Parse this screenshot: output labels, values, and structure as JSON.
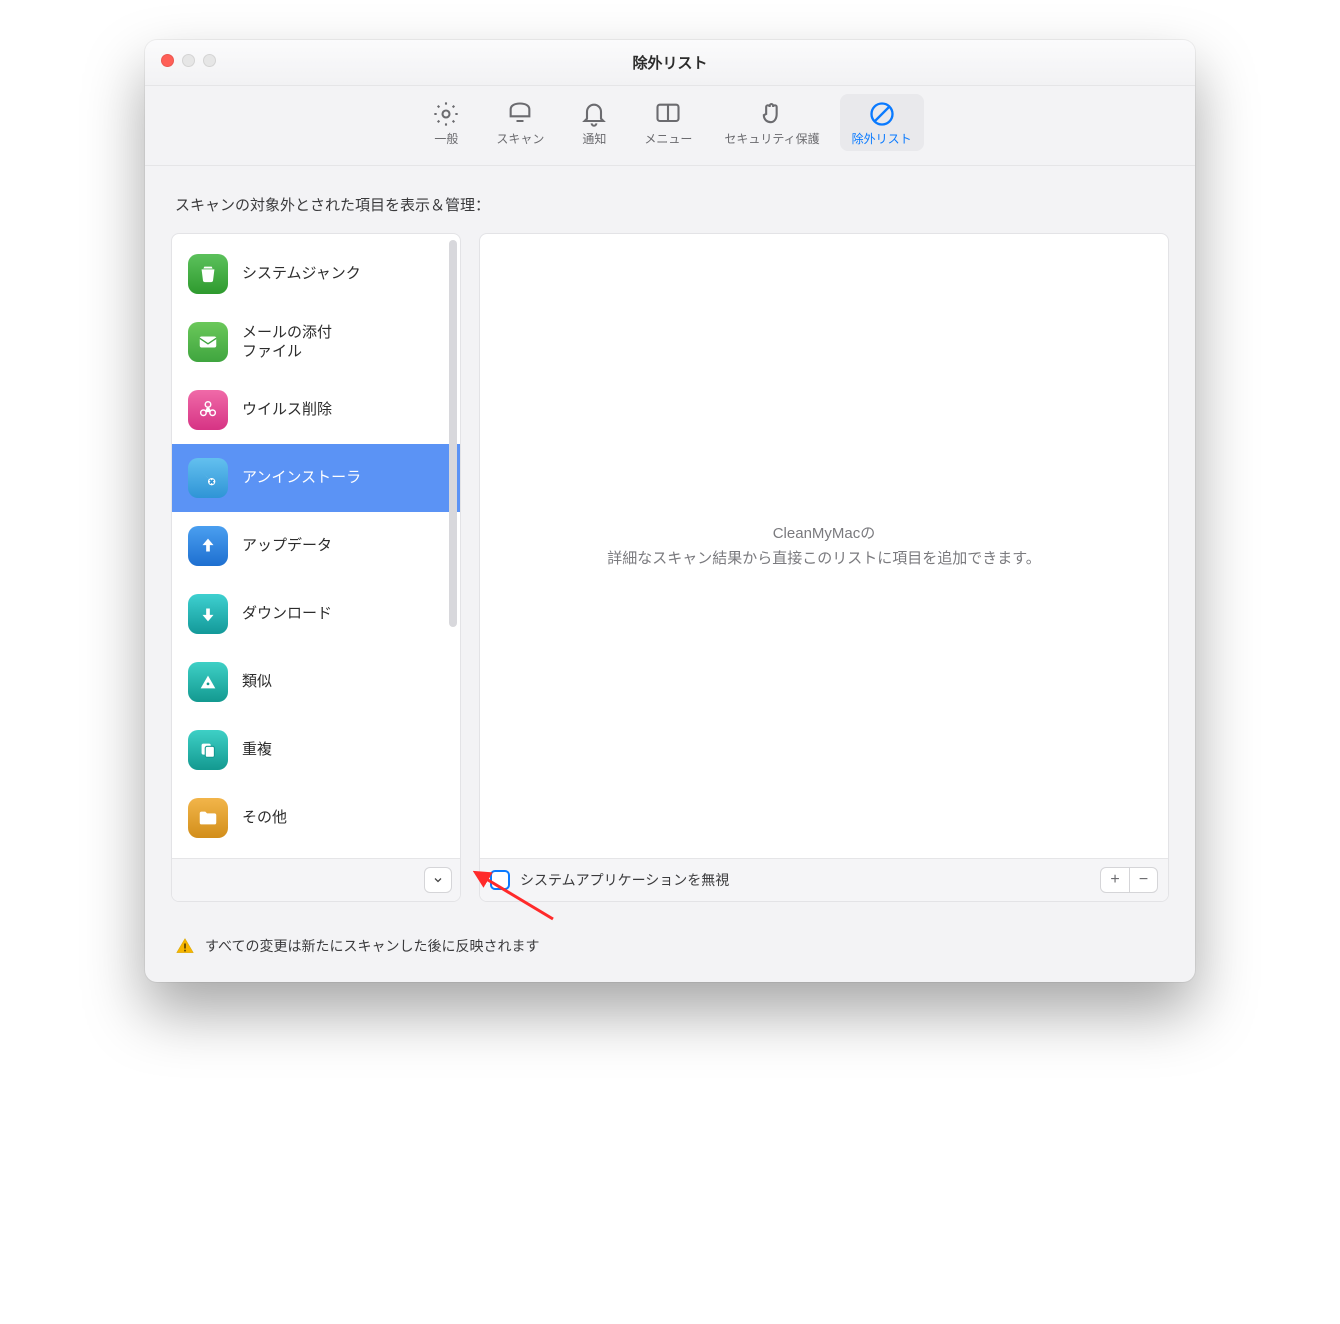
{
  "window": {
    "title": "除外リスト"
  },
  "toolbar": {
    "items": [
      {
        "label": "一般"
      },
      {
        "label": "スキャン"
      },
      {
        "label": "通知"
      },
      {
        "label": "メニュー"
      },
      {
        "label": "セキュリティ保護"
      },
      {
        "label": "除外リスト"
      }
    ],
    "active_index": 5
  },
  "section_label": "スキャンの対象外とされた項目を表示＆管理：",
  "sidebar": {
    "items": [
      {
        "label": "システムジャンク",
        "icon": "trash-icon",
        "color": "#3fa53f"
      },
      {
        "label": "メールの添付\nファイル",
        "icon": "mail-icon",
        "color": "#4faf3f"
      },
      {
        "label": "ウイルス削除",
        "icon": "biohazard-icon",
        "color": "#e24a8f"
      },
      {
        "label": "アンインストーラ",
        "icon": "uninstall-icon",
        "color": "#3aa0e8",
        "selected": true
      },
      {
        "label": "アップデータ",
        "icon": "arrow-up-icon",
        "color": "#2f7de0"
      },
      {
        "label": "ダウンロード",
        "icon": "arrow-down-icon",
        "color": "#1fb5b5"
      },
      {
        "label": "類似",
        "icon": "triangle-icon",
        "color": "#1fb5b5"
      },
      {
        "label": "重複",
        "icon": "duplicate-icon",
        "color": "#1fb5b5"
      },
      {
        "label": "その他",
        "icon": "folder-icon",
        "color": "#e6a52e"
      }
    ]
  },
  "main": {
    "empty_line1": "CleanMyMacの",
    "empty_line2": "詳細なスキャン結果から直接このリストに項目を追加できます。",
    "checkbox_label": "システムアプリケーションを無視",
    "checkbox_checked": false,
    "plus": "+",
    "minus": "−"
  },
  "footer_note": "すべての変更は新たにスキャンした後に反映されます"
}
